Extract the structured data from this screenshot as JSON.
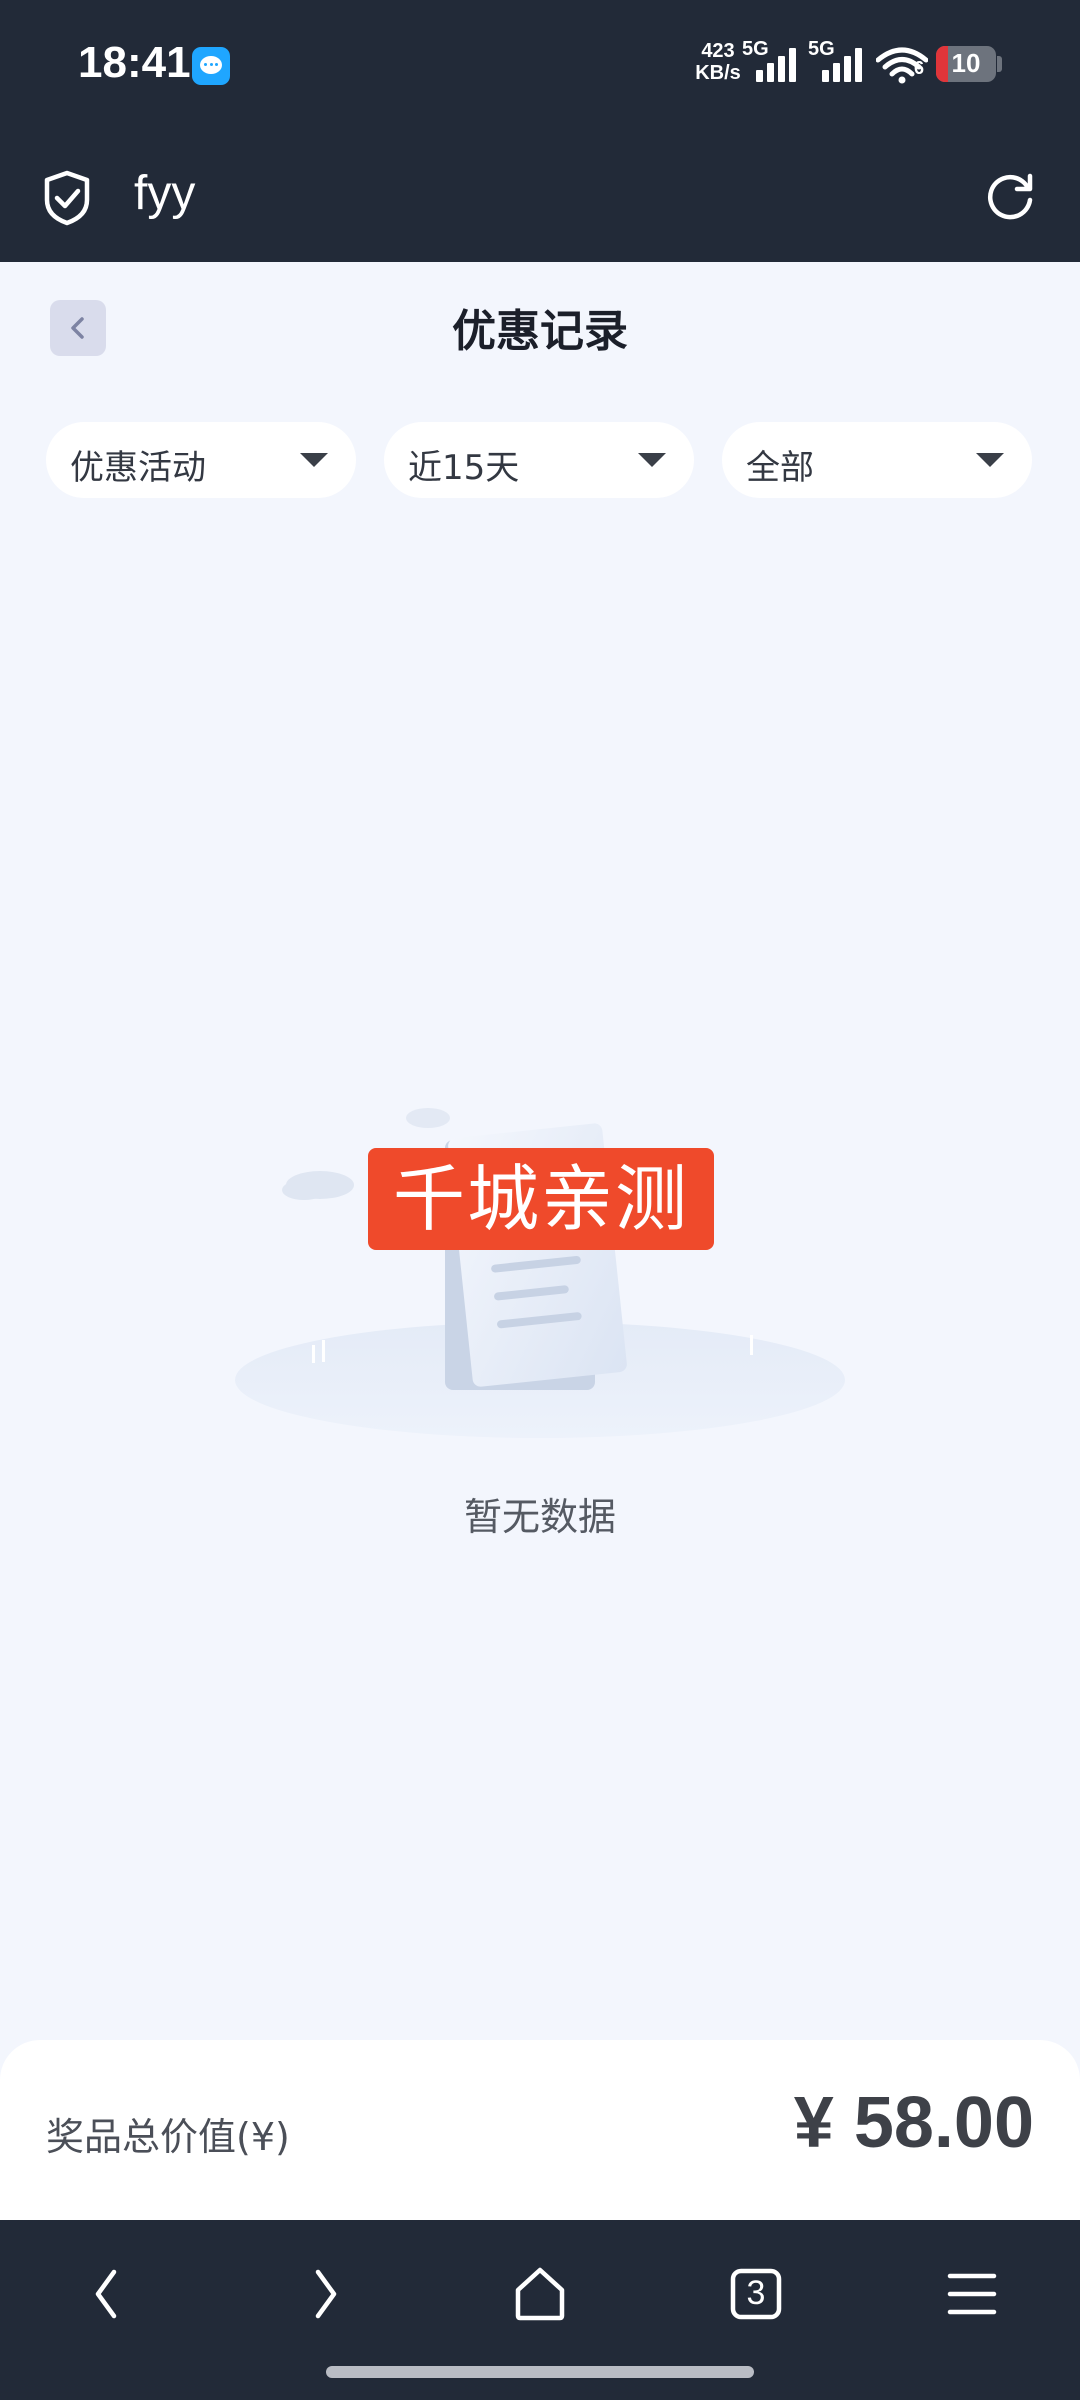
{
  "status_bar": {
    "time": "18:41",
    "net_speed_value": "423",
    "net_speed_unit": "KB/s",
    "network_1": "5G",
    "network_2": "5G",
    "wifi_label": "6",
    "battery_level": "10",
    "battery_color": "#e0353a"
  },
  "browser": {
    "site_title": "fyy",
    "icons": [
      "shield-check-icon",
      "reload-icon"
    ]
  },
  "page": {
    "title": "优惠记录",
    "filters": [
      {
        "label": "优惠活动"
      },
      {
        "label": "近15天"
      },
      {
        "label": "全部"
      }
    ],
    "watermark_text": "千城亲测",
    "empty_text": "暂无数据"
  },
  "summary": {
    "label": "奖品总价值(¥)",
    "value": "¥ 58.00"
  },
  "nav": {
    "tab_count": "3",
    "icons": [
      "back-arrow-icon",
      "forward-arrow-icon",
      "home-icon",
      "tabs-icon",
      "menu-icon"
    ]
  },
  "colors": {
    "bar_background": "#222a38",
    "page_background": "#f3f6fd",
    "watermark": "#ef4a2b"
  }
}
